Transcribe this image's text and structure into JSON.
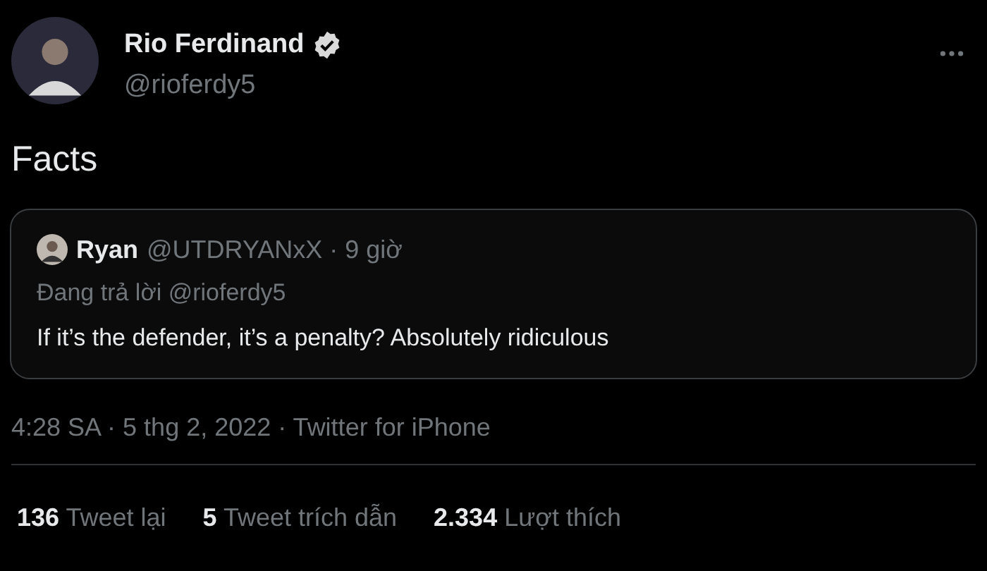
{
  "author": {
    "name": "Rio Ferdinand",
    "verified": true,
    "handle": "@rioferdy5"
  },
  "text": "Facts",
  "quote": {
    "name": "Ryan",
    "meta": "@UTDRYANxX · 9 giờ",
    "reply_to": "Đang trả lời @rioferdy5",
    "text": "If it’s the defender, it’s a penalty? Absolutely ridiculous"
  },
  "timestamp": "4:28 SA · 5 thg 2, 2022 · Twitter for iPhone",
  "stats": [
    {
      "count": "136",
      "label": "Tweet lại"
    },
    {
      "count": "5",
      "label": "Tweet trích dẫn"
    },
    {
      "count": "2.334",
      "label": "Lượt thích"
    }
  ]
}
